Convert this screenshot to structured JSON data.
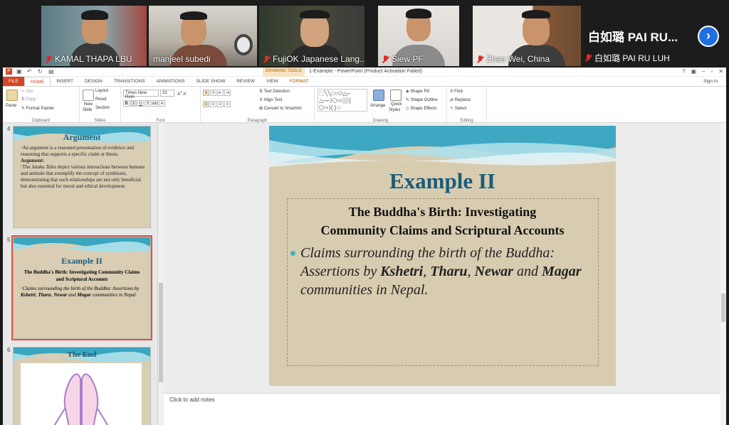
{
  "participants": [
    {
      "name": "KAMAL THAPA LBU"
    },
    {
      "name": "manjeel subedi"
    },
    {
      "name": "FujiOK Japanese Lang..."
    },
    {
      "name": "Siew PF"
    },
    {
      "name": "Zhao Wei,  China"
    }
  ],
  "name_tile": {
    "display": "白如璐 PAI RU...",
    "name": "白如璐 PAI RU LUH"
  },
  "ppt": {
    "contextual_tab": "DRAWING TOOLS",
    "window_title": "1-Example - PowerPoint (Product Activation Failed)",
    "tabs": [
      "FILE",
      "HOME",
      "INSERT",
      "DESIGN",
      "TRANSITIONS",
      "ANIMATIONS",
      "SLIDE SHOW",
      "REVIEW",
      "VIEW",
      "FORMAT"
    ],
    "sign_in": "Sign in",
    "ribbon": {
      "paste": "Paste",
      "cut": "Cut",
      "copy": "Copy",
      "format_painter": "Format Painter",
      "clipboard": "Clipboard",
      "new_slide_1": "New",
      "new_slide_2": "Slide",
      "layout": "Layout",
      "reset": "Reset",
      "section": "Section",
      "slides": "Slides",
      "font_name": "Times New Rom",
      "font_size": "32",
      "font": "Font",
      "text_direction": "Text Direction",
      "align_text": "Align Text",
      "convert_smartart": "Convert to SmartArt",
      "paragraph": "Paragraph",
      "arrange": "Arrange",
      "quick_1": "Quick",
      "quick_2": "Styles",
      "shape_fill": "Shape Fill",
      "shape_outline": "Shape Outline",
      "shape_effects": "Shape Effects",
      "drawing": "Drawing",
      "find": "Find",
      "replace": "Replace",
      "select": "Select",
      "editing": "Editing"
    },
    "thumbs": [
      {
        "num": "4",
        "title": "Argument",
        "bullet1": "An argument is a reasoned presentation of evidence and reasoning that supports a specific claim or thesis.",
        "heading": "Argument:",
        "bullet2_pre": "The ",
        "bullet2_em": "Jataka Tales",
        "bullet2_post": " depict various interactions between humans and animals that exemplify the concept of symbiosis, demonstrating that such relationships are not only beneficial but also essential for moral and ethical development."
      },
      {
        "num": "5",
        "title": "Example II",
        "subtitle": "The Buddha's Birth: Investigating Community Claims and Scriptural Accounts",
        "bullet_a": "Claims surrounding the birth of the Buddha: Assertions by ",
        "k": "Kshetri",
        "c1": ", ",
        "t": "Tharu",
        "c2": ", ",
        "n": "Newar",
        "and": " and ",
        "m": "Magar",
        "end": " communities in Nepal."
      },
      {
        "num": "6",
        "title": "The End"
      }
    ],
    "slide": {
      "title": "Example II",
      "subtitle_1": "The Buddha's Birth: Investigating",
      "subtitle_2": "Community Claims and Scriptural Accounts",
      "bullet_a": "Claims surrounding the birth of the Buddha: Assertions by ",
      "k": "Kshetri",
      "c1": ", ",
      "t": "Tharu",
      "c2": ", ",
      "n": "Newar",
      "and": " and ",
      "m": "Magar",
      "end": " communities in Nepal."
    },
    "notes_placeholder": "Click to add notes"
  }
}
